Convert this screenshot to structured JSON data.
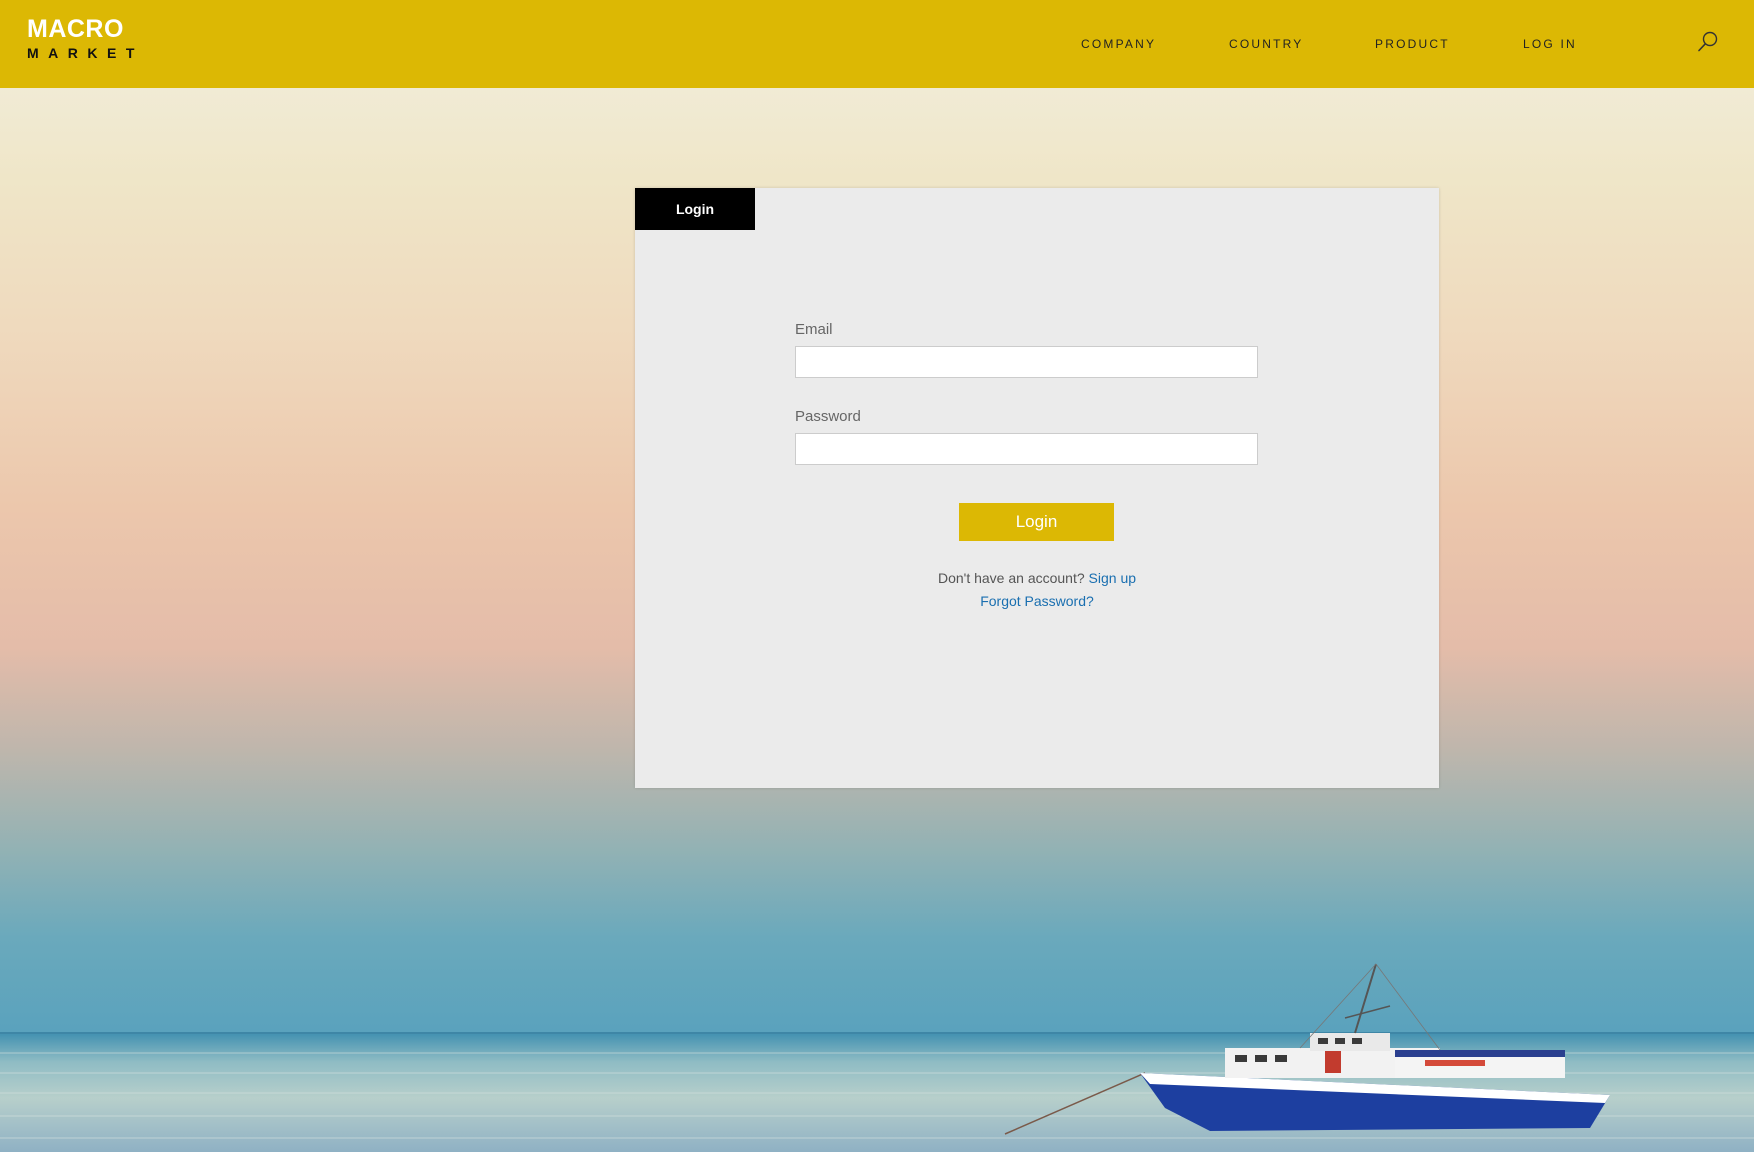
{
  "header": {
    "logo_top": "MACRO",
    "logo_bottom": "MARKET",
    "nav": [
      "COMPANY",
      "COUNTRY",
      "PRODUCT",
      "LOG IN"
    ],
    "search_icon": "search-icon"
  },
  "login": {
    "tab_label": "Login",
    "email_label": "Email",
    "email_value": "",
    "password_label": "Password",
    "password_value": "",
    "button_label": "Login",
    "signup_prompt": "Don't have an account?",
    "signup_link": "Sign up",
    "forgot_link": "Forgot Password?"
  },
  "colors": {
    "brand_yellow": "#dcb804",
    "tab_black": "#000000",
    "panel_bg": "#ebebeb",
    "link_blue": "#1a6fb0"
  }
}
